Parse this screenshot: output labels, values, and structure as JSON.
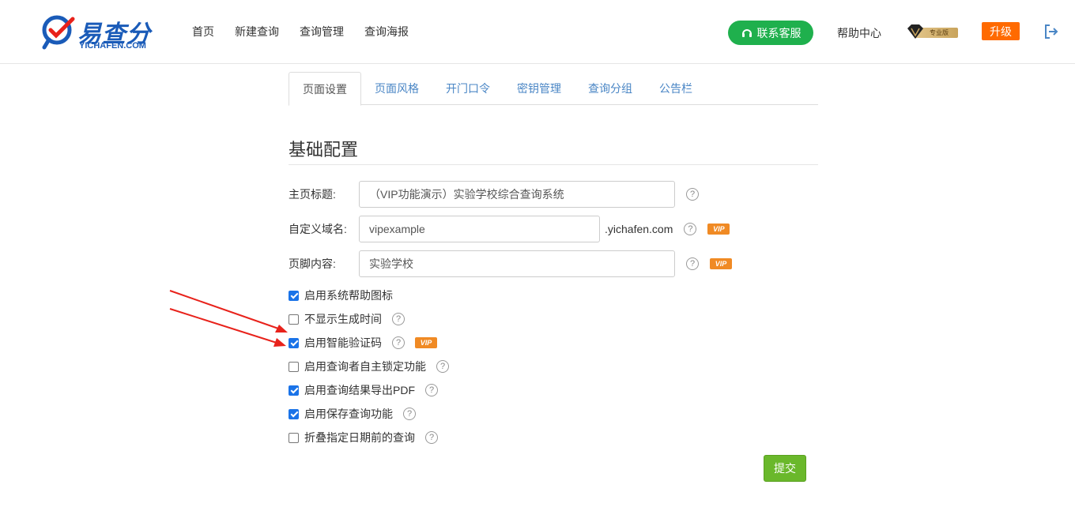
{
  "brand": {
    "name_cn": "易查分",
    "name_en": "YICHAFEN.COM",
    "color": "#1a5bb8"
  },
  "nav": [
    {
      "label": "首页"
    },
    {
      "label": "新建查询"
    },
    {
      "label": "查询管理"
    },
    {
      "label": "查询海报"
    }
  ],
  "header": {
    "service_label": "联系客服",
    "help_label": "帮助中心",
    "pro_badge": "专业版",
    "upgrade_label": "升级"
  },
  "tabs": [
    {
      "label": "页面设置",
      "active": true
    },
    {
      "label": "页面风格",
      "active": false
    },
    {
      "label": "开门口令",
      "active": false
    },
    {
      "label": "密钥管理",
      "active": false
    },
    {
      "label": "查询分组",
      "active": false
    },
    {
      "label": "公告栏",
      "active": false
    }
  ],
  "section_title": "基础配置",
  "fields": {
    "title": {
      "label": "主页标题:",
      "value": "（VIP功能演示）实验学校综合查询系统"
    },
    "domain": {
      "label": "自定义域名:",
      "value": "vipexample",
      "suffix": ".yichafen.com",
      "vip": "VIP"
    },
    "footer": {
      "label": "页脚内容:",
      "value": "实验学校",
      "vip": "VIP"
    }
  },
  "help_mark": "?",
  "options": [
    {
      "label": "启用系统帮助图标",
      "checked": true,
      "help": false,
      "vip": ""
    },
    {
      "label": "不显示生成时间",
      "checked": false,
      "help": true,
      "vip": ""
    },
    {
      "label": "启用智能验证码",
      "checked": true,
      "help": true,
      "vip": "VIP"
    },
    {
      "label": "启用查询者自主锁定功能",
      "checked": false,
      "help": true,
      "vip": ""
    },
    {
      "label": "启用查询结果导出PDF",
      "checked": true,
      "help": true,
      "vip": ""
    },
    {
      "label": "启用保存查询功能",
      "checked": true,
      "help": true,
      "vip": ""
    },
    {
      "label": "折叠指定日期前的查询",
      "checked": false,
      "help": true,
      "vip": ""
    }
  ],
  "submit_label": "提交",
  "colors": {
    "accent_green": "#1fb04d",
    "upgrade_orange": "#ff6a00",
    "submit_green": "#6ab82b",
    "vip_orange": "#f08a24",
    "annotation_red": "#e8221b"
  }
}
